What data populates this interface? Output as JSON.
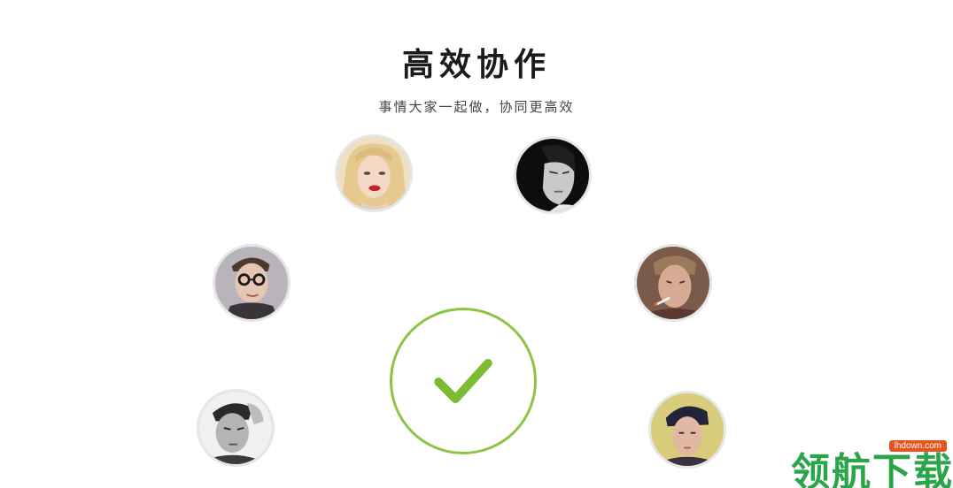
{
  "header": {
    "title": "高效协作",
    "subtitle": "事情大家一起做，协同更高效"
  },
  "avatars": [
    {
      "id": "woman-blonde",
      "tone": "warm"
    },
    {
      "id": "man-monochrome",
      "tone": "bw"
    },
    {
      "id": "man-glasses",
      "tone": "cool"
    },
    {
      "id": "man-smoking",
      "tone": "warm"
    },
    {
      "id": "man-hand-hair",
      "tone": "bw"
    },
    {
      "id": "young-man",
      "tone": "warm"
    }
  ],
  "center": {
    "icon": "check-icon",
    "ring_color": "#8cc541",
    "check_color": "#7dbb33"
  },
  "watermark": {
    "text": "领航下载",
    "badge": "lhdown.com",
    "color": "#2aa54a",
    "badge_color": "#e5541f"
  }
}
